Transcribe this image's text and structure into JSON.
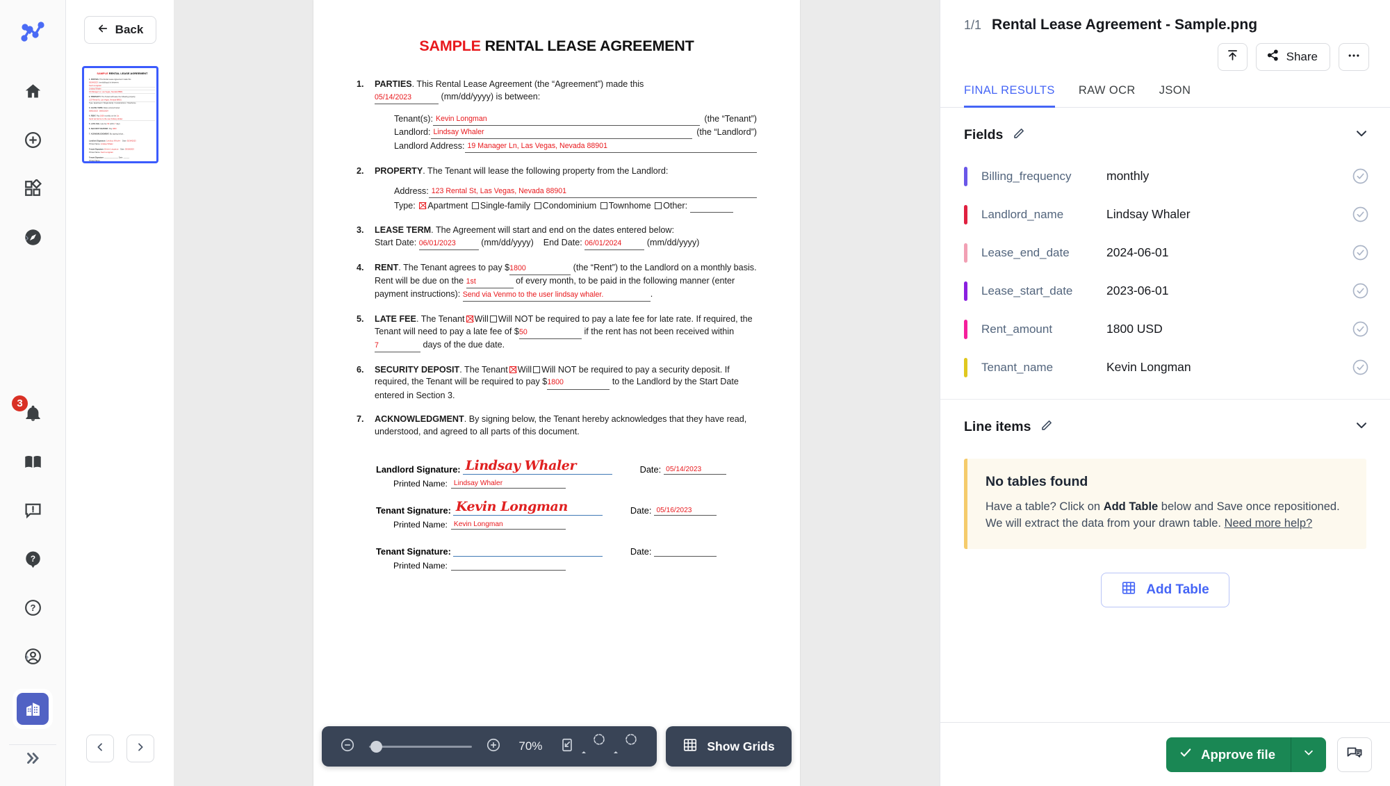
{
  "rail": {
    "logo_icon": "node-graph-logo",
    "top_items": [
      {
        "name": "home",
        "icon": "home-icon"
      },
      {
        "name": "add",
        "icon": "plus-circle-icon"
      },
      {
        "name": "apps",
        "icon": "apps-grid-icon"
      },
      {
        "name": "explore",
        "icon": "compass-icon",
        "has_chevron": true
      }
    ],
    "bottom_items": [
      {
        "name": "notifications",
        "icon": "bell-icon",
        "badge": "3"
      },
      {
        "name": "docs",
        "icon": "book-icon"
      },
      {
        "name": "feedback",
        "icon": "feedback-bubble-icon"
      },
      {
        "name": "help-chat",
        "icon": "question-bubble-icon"
      },
      {
        "name": "support",
        "icon": "question-circle-icon"
      },
      {
        "name": "account",
        "icon": "account-circle-icon",
        "has_chevron": true
      },
      {
        "name": "organization",
        "icon": "building-icon",
        "active": true
      }
    ],
    "expand_icon": "double-chevron-right-icon",
    "active_color": "#5162c4",
    "badge_color": "#d93025"
  },
  "thumbnails": {
    "back_label": "Back",
    "back_icon": "arrow-left-icon",
    "prev_icon": "chevron-left-icon",
    "next_icon": "chevron-right-icon",
    "selected_border_color": "#3b5bfd"
  },
  "viewer": {
    "reload_icon": "refresh-external-icon",
    "toolbar": {
      "zoom_out_icon": "minus-circle-icon",
      "zoom_in_icon": "plus-circle-icon",
      "zoom_level": "70%",
      "fit_icon": "fit-to-screen-icon",
      "rotate_left_icon": "rotate-left-icon",
      "rotate_right_icon": "rotate-right-icon",
      "show_grids_label": "Show Grids",
      "show_grids_icon": "grid-table-icon"
    }
  },
  "document": {
    "title_highlight": "SAMPLE",
    "title_rest": " RENTAL LEASE AGREEMENT",
    "clauses": [
      {
        "num": "1.",
        "heading": "PARTIES",
        "text": ". This Rental Lease Agreement (the “Agreement”) made this",
        "date_value": "05/14/2023",
        "date_suffix": "(mm/dd/yyyy) is between:",
        "rows": [
          {
            "label": "Tenant(s):",
            "value": "Kevin Longman",
            "suffix": "(the “Tenant”)"
          },
          {
            "label": "Landlord:",
            "value": "Lindsay Whaler",
            "suffix": "(the “Landlord”)"
          },
          {
            "label": "Landlord Address:",
            "value": "19 Manager Ln, Las Vegas, Nevada 88901",
            "suffix": ""
          }
        ]
      },
      {
        "num": "2.",
        "heading": "PROPERTY",
        "text": ". The Tenant will lease the following property from the Landlord:",
        "address_label": "Address:",
        "address_value": "123 Rental St, Las Vegas, Nevada 88901",
        "type_label": "Type:",
        "types": [
          {
            "label": "Apartment",
            "checked": true
          },
          {
            "label": "Single-family",
            "checked": false
          },
          {
            "label": "Condominium",
            "checked": false
          },
          {
            "label": "Townhome",
            "checked": false
          },
          {
            "label": "Other:",
            "checked": false
          }
        ]
      },
      {
        "num": "3.",
        "heading": "LEASE TERM",
        "text": ". The Agreement will start and end on the dates entered below:",
        "start_label": "Start Date:",
        "start_value": "06/01/2023",
        "start_fmt": "(mm/dd/yyyy)",
        "end_label": "End Date:",
        "end_value": "06/01/2024",
        "end_fmt": "(mm/dd/yyyy)"
      },
      {
        "num": "4.",
        "heading": "RENT",
        "t1": ". The Tenant agrees to pay $",
        "rent": "1800",
        "t2": "(the “Rent”) to the Landlord on a monthly basis. Rent will be due on the",
        "due_day": "1st",
        "t3": "of every month, to be paid in the following manner (enter payment instructions):",
        "instructions": "Send via Venmo to the user lindsay whaler."
      },
      {
        "num": "5.",
        "heading": "LATE FEE",
        "t1": ". The Tenant",
        "will_label": "Will",
        "willnot_label": "Will NOT",
        "t2": "be required to pay a late fee for late rate. If required, the Tenant will need to pay a late fee of $",
        "fee": "50",
        "t3": "if the rent has not been received within",
        "days": "7",
        "t4": "days of the due date.",
        "will_checked": true
      },
      {
        "num": "6.",
        "heading": "SECURITY DEPOSIT",
        "t1": ". The Tenant",
        "will_label": "Will",
        "willnot_label": "Will NOT",
        "t2": "be required to pay a security deposit. If required, the Tenant will be required to pay $",
        "deposit": "1800",
        "t3": "to the Landlord by the Start Date entered in Section 3.",
        "will_checked": true
      },
      {
        "num": "7.",
        "heading": "ACKNOWLEDGMENT",
        "text": ". By signing below, the Tenant hereby acknowledges that they have read, understood, and agreed to all parts of this document."
      }
    ],
    "signatures": [
      {
        "label": "Landlord Signature:",
        "script": "Lindsay Whaler",
        "date_label": "Date:",
        "date": "05/14/2023",
        "printed_label": "Printed Name:",
        "printed": "Lindsay Whaler"
      },
      {
        "label": "Tenant Signature:",
        "script": "Kevin Longman",
        "date_label": "Date:",
        "date": "05/16/2023",
        "printed_label": "Printed Name:",
        "printed": "Kevin Longman"
      },
      {
        "label": "Tenant Signature:",
        "script": "",
        "date_label": "Date:",
        "date": "",
        "printed_label": "Printed Name:",
        "printed": ""
      }
    ]
  },
  "right_panel": {
    "page_indicator": "1/1",
    "file_name": "Rental Lease Agreement - Sample.png",
    "upload_icon": "upload-icon",
    "share_label": "Share",
    "share_icon": "share-icon",
    "more_icon": "more-horizontal-icon",
    "tabs": [
      {
        "label": "FINAL RESULTS",
        "active": true
      },
      {
        "label": "RAW OCR",
        "active": false
      },
      {
        "label": "JSON",
        "active": false
      }
    ],
    "fields_section": {
      "title": "Fields",
      "edit_icon": "pencil-icon",
      "collapse_icon": "chevron-down-icon",
      "rows": [
        {
          "name": "Billing_frequency",
          "value": "monthly",
          "color": "#6a57e8",
          "status_icon": "check-circle-icon"
        },
        {
          "name": "Landlord_name",
          "value": "Lindsay Whaler",
          "color": "#e02040",
          "status_icon": "check-circle-icon"
        },
        {
          "name": "Lease_end_date",
          "value": "2024-06-01",
          "color": "#f2a0b4",
          "status_icon": "check-circle-icon"
        },
        {
          "name": "Lease_start_date",
          "value": "2023-06-01",
          "color": "#8a1fe0",
          "status_icon": "check-circle-icon"
        },
        {
          "name": "Rent_amount",
          "value": "1800 USD",
          "color": "#f51f9c",
          "status_icon": "check-circle-icon"
        },
        {
          "name": "Tenant_name",
          "value": "Kevin Longman",
          "color": "#e0c81f",
          "status_icon": "check-circle-icon"
        }
      ]
    },
    "line_items_section": {
      "title": "Line items",
      "edit_icon": "pencil-icon",
      "collapse_icon": "chevron-down-icon",
      "notice_title": "No tables found",
      "notice_l1_a": "Have a table? Click on ",
      "notice_l1_b": "Add Table",
      "notice_l1_c": " below and Save once repositioned.",
      "notice_l2_a": "We will extract the data from your drawn table. ",
      "notice_link": "Need more help?",
      "add_table_label": "Add Table",
      "add_table_icon": "grid-table-icon"
    },
    "footer": {
      "approve_label": "Approve file",
      "approve_check_icon": "check-icon",
      "approve_caret_icon": "chevron-down-icon",
      "note_icon": "comment-icon",
      "approve_color": "#1a8754"
    }
  }
}
